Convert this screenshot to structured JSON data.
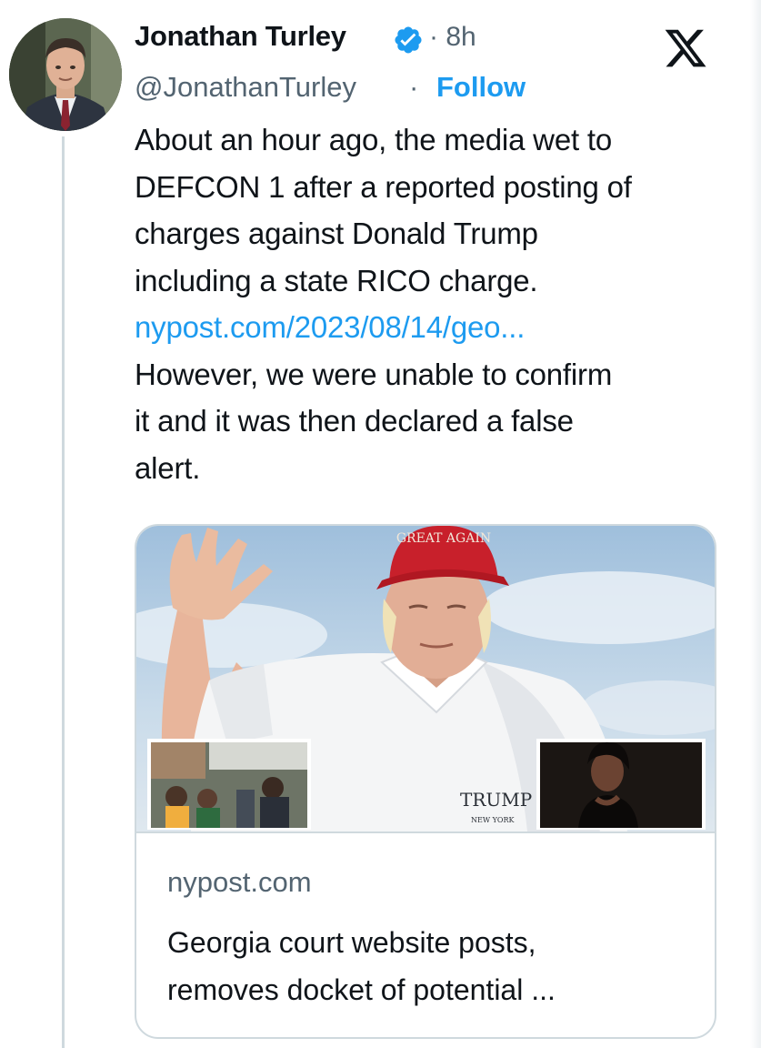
{
  "author": {
    "name": "Jonathan Turley",
    "handle": "@JonathanTurley",
    "time": "· 8h",
    "follow_separator": "·",
    "follow_label": "Follow",
    "verified": true
  },
  "platform_icon": "x-logo-icon",
  "tweet": {
    "lines": [
      "About an hour ago, the media wet to",
      "DEFCON 1 after a reported posting of",
      "charges against Donald Trump",
      "including a state RICO charge."
    ],
    "link": "nypost.com/2023/08/14/geo...",
    "lines_after_link": [
      "However, we were unable to confirm",
      "it and it was then declared a false",
      "alert."
    ]
  },
  "card": {
    "domain": "nypost.com",
    "title_lines": [
      "Georgia court website posts,",
      "removes docket of potential ..."
    ],
    "image_text": {
      "cap_text": "GREAT AGAIN",
      "shirt_logo": "TRUMP",
      "shirt_sub": "NEW YORK"
    }
  },
  "colors": {
    "accent": "#1d9bf0",
    "text_primary": "#0f1419",
    "text_secondary": "#536471",
    "border": "#cfd9de"
  }
}
